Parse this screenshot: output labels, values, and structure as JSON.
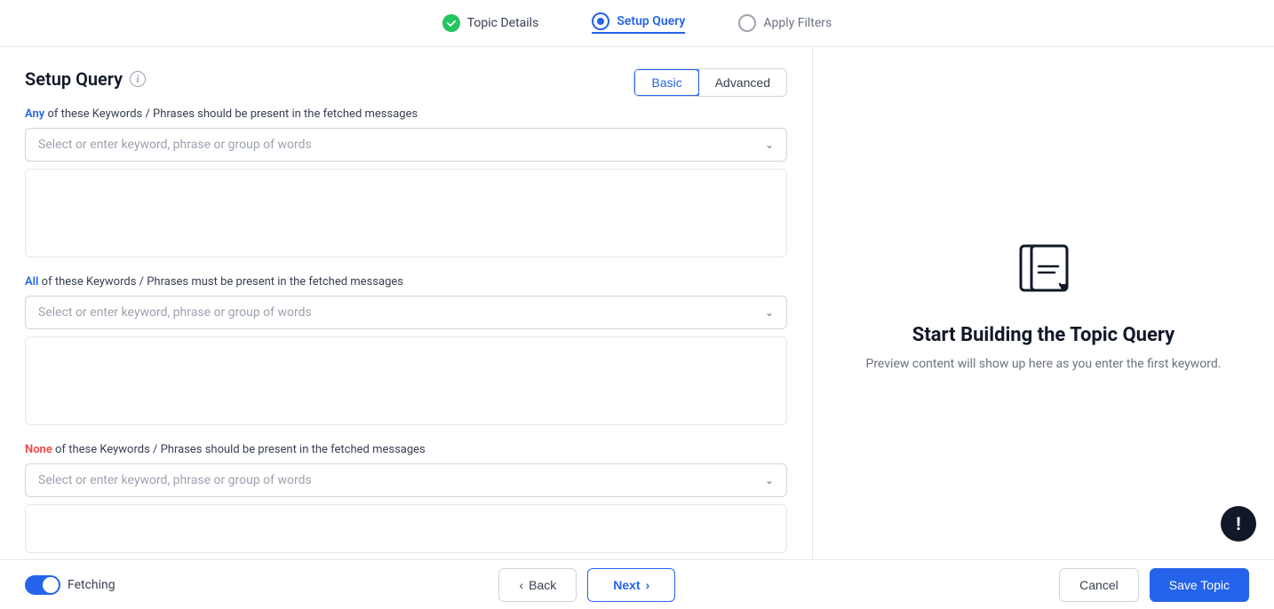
{
  "stepper": {
    "steps": [
      {
        "id": "topic-details",
        "label": "Topic Details",
        "status": "completed"
      },
      {
        "id": "setup-query",
        "label": "Setup Query",
        "status": "active"
      },
      {
        "id": "apply-filters",
        "label": "Apply Filters",
        "status": "pending"
      }
    ]
  },
  "page": {
    "title": "Setup Query",
    "info_icon": "i",
    "mode_basic": "Basic",
    "mode_advanced": "Advanced"
  },
  "sections": {
    "any": {
      "label_prefix": "Any",
      "label_suffix": " of these Keywords / Phrases should be present in the fetched messages",
      "placeholder": "Select or enter keyword, phrase or group of words"
    },
    "all": {
      "label_prefix": "All",
      "label_suffix": " of these Keywords / Phrases must be present in the fetched messages",
      "placeholder": "Select or enter keyword, phrase or group of words"
    },
    "none": {
      "label_prefix": "None",
      "label_suffix": " of these Keywords / Phrases should be present in the fetched messages",
      "placeholder": "Select or enter keyword, phrase or group of words"
    }
  },
  "preview": {
    "title": "Start Building the Topic Query",
    "subtitle": "Preview content will show up here as you enter the first keyword."
  },
  "bottom": {
    "fetching_label": "Fetching",
    "back_label": "Back",
    "next_label": "Next",
    "cancel_label": "Cancel",
    "save_label": "Save Topic"
  }
}
